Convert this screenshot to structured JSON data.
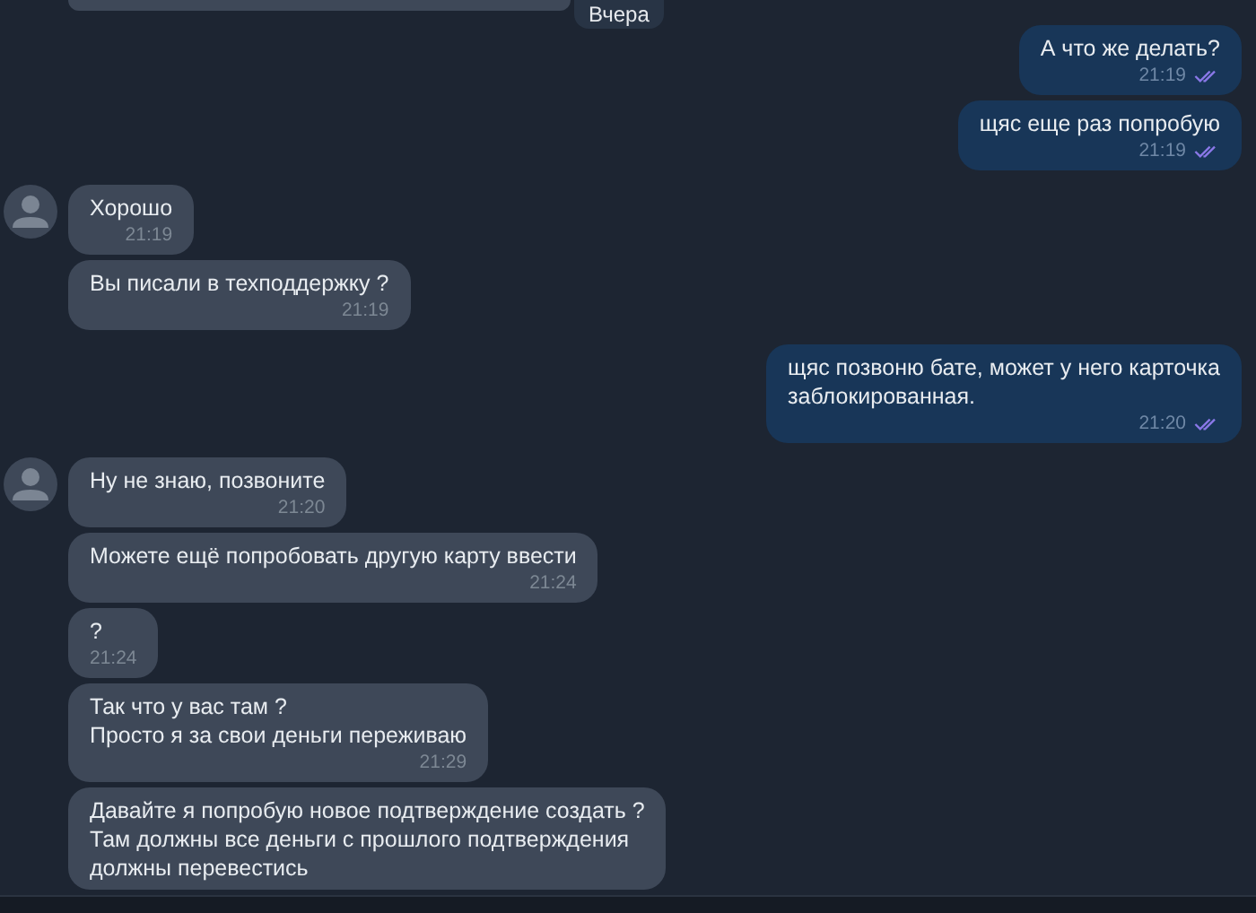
{
  "date_separator": "Вчера",
  "messages": [
    {
      "kind": "outgoing",
      "text": "А что же делать?",
      "time": "21:19",
      "read": true
    },
    {
      "kind": "outgoing",
      "text": "щяс еще раз попробую",
      "time": "21:19",
      "read": true
    },
    {
      "kind": "incoming",
      "avatar": true,
      "text": "Хорошо",
      "time": "21:19"
    },
    {
      "kind": "incoming",
      "avatar": false,
      "text": "Вы писали в техподдержку ?",
      "time": "21:19"
    },
    {
      "kind": "outgoing",
      "text": "щяс позвоню бате, может у него карточка\nзаблокированная.",
      "time": "21:20",
      "read": true
    },
    {
      "kind": "incoming",
      "avatar": true,
      "text": "Ну не знаю, позвоните",
      "time": "21:20"
    },
    {
      "kind": "incoming",
      "avatar": false,
      "text": "Можете ещё попробовать другую карту ввести",
      "time": "21:24"
    },
    {
      "kind": "incoming",
      "avatar": false,
      "text": "?",
      "time": "21:24"
    },
    {
      "kind": "incoming",
      "avatar": false,
      "text": "Так что у вас там ?\nПросто я за свои деньги переживаю",
      "time": "21:29"
    },
    {
      "kind": "incoming",
      "avatar": false,
      "text": "Давайте я попробую новое подтверждение создать ?\nТам должны все деньги с прошлого подтверждения\nдолжны перевестись"
    }
  ]
}
